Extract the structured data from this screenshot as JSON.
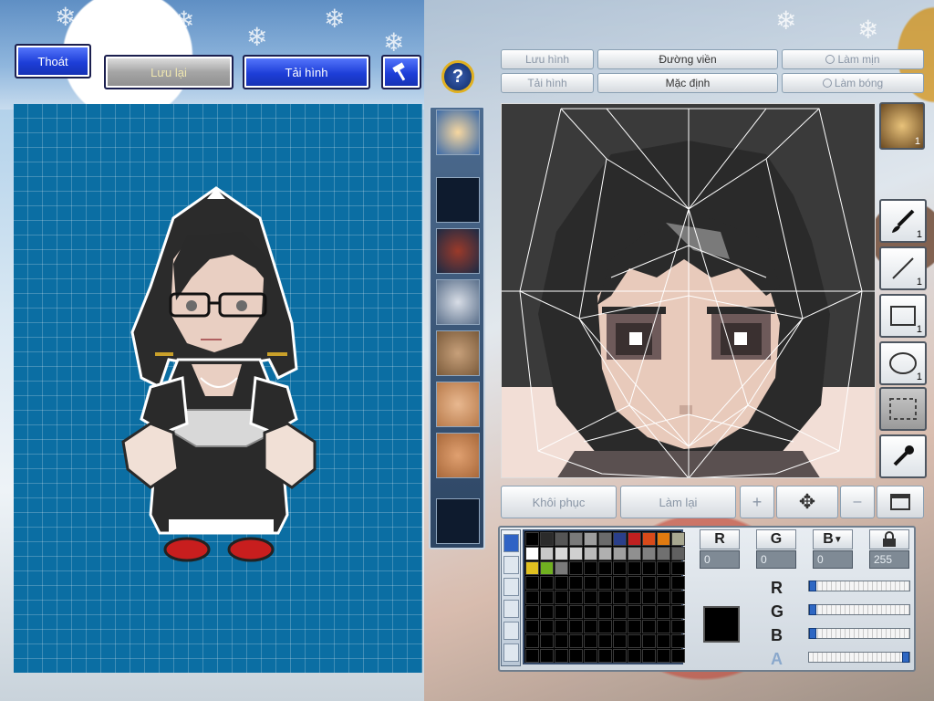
{
  "top_buttons": {
    "exit": "Thoát",
    "save": "Lưu lại",
    "load_image": "Tải hình",
    "hammer_icon": "hammer-icon",
    "help_icon": "question-icon"
  },
  "editor_buttons": {
    "save_image": "Lưu hình",
    "load_image": "Tải hình",
    "outline": "Đường viền",
    "default": "Mặc định",
    "smooth": "Làm mịn",
    "shade": "Làm bóng"
  },
  "bottom_buttons": {
    "restore": "Khôi phục",
    "redo": "Làm lại"
  },
  "tools": [
    {
      "name": "brush-icon",
      "count": "1"
    },
    {
      "name": "line-icon",
      "count": "1"
    },
    {
      "name": "rectangle-icon",
      "count": "1"
    },
    {
      "name": "ellipse-icon",
      "count": "1"
    },
    {
      "name": "selection-icon",
      "count": ""
    },
    {
      "name": "eyedropper-icon",
      "count": ""
    }
  ],
  "face_thumb_count": "1",
  "palette": {
    "colors": [
      "#000000",
      "#2b2b2b",
      "#555555",
      "#7a7a7a",
      "#9e9e9e",
      "#6b6b6b",
      "#2a3f8a",
      "#c02020",
      "#d84a1a",
      "#e07a10",
      "#a8a890",
      "#ffffff",
      "#c8c8c8",
      "#d8d8d8",
      "#d0d0d0",
      "#bbbbbb",
      "#b0b0b0",
      "#a0a0a0",
      "#909090",
      "#808080",
      "#707070",
      "#606060",
      "#e0c020",
      "#70b020",
      "#7a7a7a"
    ],
    "rgb": {
      "r_label": "R",
      "g_label": "G",
      "b_label": "B",
      "r": "0",
      "g": "0",
      "b": "0",
      "a": "255"
    },
    "sliders": [
      {
        "label": "R",
        "value": 0
      },
      {
        "label": "G",
        "value": 0
      },
      {
        "label": "B",
        "value": 0
      },
      {
        "label": "A",
        "value": 255
      }
    ]
  }
}
